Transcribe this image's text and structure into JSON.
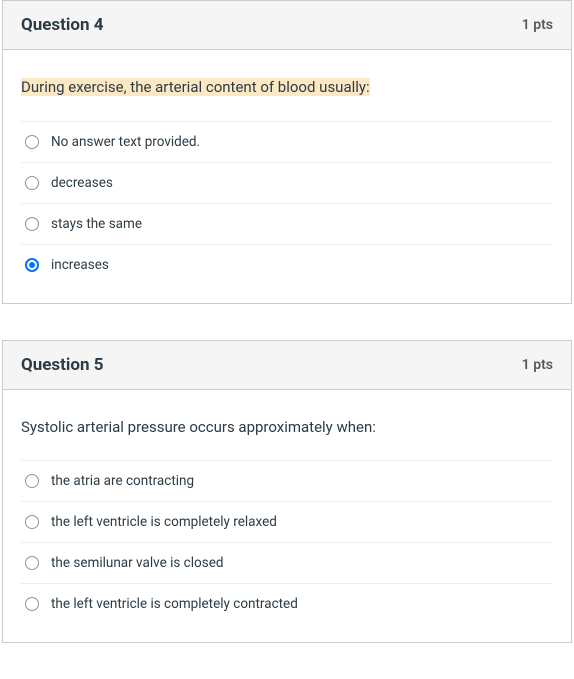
{
  "questions": [
    {
      "title": "Question 4",
      "points": "1 pts",
      "text": "During exercise, the arterial content of blood usually:",
      "highlighted": true,
      "answers": [
        {
          "label": "No answer text provided.",
          "selected": false
        },
        {
          "label": "decreases",
          "selected": false
        },
        {
          "label": "stays the same",
          "selected": false
        },
        {
          "label": "increases",
          "selected": true
        }
      ]
    },
    {
      "title": "Question 5",
      "points": "1 pts",
      "text": "Systolic arterial pressure occurs approximately when:",
      "highlighted": false,
      "answers": [
        {
          "label": "the atria are contracting",
          "selected": false
        },
        {
          "label": "the left ventricle is completely relaxed",
          "selected": false
        },
        {
          "label": "the semilunar valve is closed",
          "selected": false
        },
        {
          "label": "the left ventricle is completely contracted",
          "selected": false
        }
      ]
    }
  ]
}
